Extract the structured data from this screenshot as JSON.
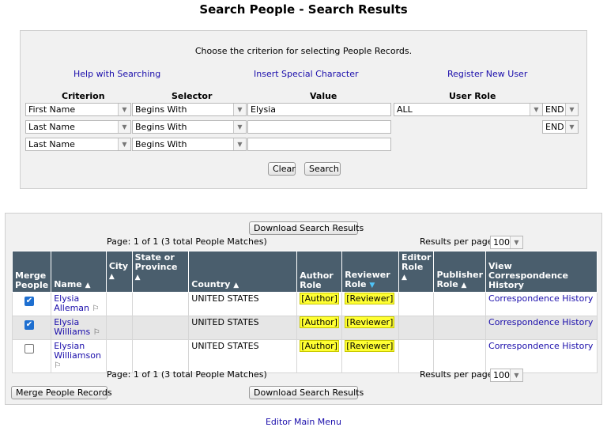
{
  "title": "Search People - Search Results",
  "search": {
    "intro": "Choose the criterion for selecting People Records.",
    "help_link": "Help with Searching",
    "special_char_link": "Insert Special Character",
    "register_link": "Register New User",
    "headers": {
      "criterion": "Criterion",
      "selector": "Selector",
      "value": "Value",
      "user_role": "User Role"
    },
    "rows": [
      {
        "criterion": "First Name",
        "selector": "Begins With",
        "value": "Elysia",
        "role": "ALL",
        "connector": "END"
      },
      {
        "criterion": "Last Name",
        "selector": "Begins With",
        "value": "",
        "connector": "END"
      },
      {
        "criterion": "Last Name",
        "selector": "Begins With",
        "value": ""
      }
    ],
    "clear_label": "Clear",
    "search_label": "Search"
  },
  "results": {
    "download_label": "Download Search Results",
    "page_info": "Page: 1 of 1 (3 total People Matches)",
    "per_page_label": "Results per page",
    "per_page_value": "100",
    "merge_label": "Merge People Records",
    "columns": {
      "merge": "Merge People",
      "name": "Name",
      "city": "City",
      "state": "State or Province",
      "country": "Country",
      "author": "Author Role",
      "reviewer": "Reviewer Role",
      "editor": "Editor Role",
      "publisher": "Publisher Role",
      "history": "View Correspondence History"
    },
    "rows": [
      {
        "checked": true,
        "first": "Elysia",
        "last": "Alleman",
        "country": "UNITED STATES",
        "author": "[Author]",
        "reviewer": "[Reviewer]",
        "history": "Correspondence History"
      },
      {
        "checked": true,
        "first": "Elysia",
        "last": "Williams",
        "country": "UNITED STATES",
        "author": "[Author]",
        "reviewer": "[Reviewer]",
        "history": "Correspondence History"
      },
      {
        "checked": false,
        "first": "Elysian",
        "last": "Williamson",
        "country": "UNITED STATES",
        "author": "[Author]",
        "reviewer": "[Reviewer]",
        "history": "Correspondence History"
      }
    ]
  },
  "footer_link": "Editor Main Menu",
  "icons": {
    "sort_up": "▲",
    "sort_down": "▼",
    "dropdown": "▼",
    "flag": "flag-icon",
    "check": "✔"
  },
  "colors": {
    "header_bg": "#4a5e6d",
    "link": "#1a0dab",
    "highlight": "#ffff33",
    "active_sort": "#4fc3f7"
  }
}
